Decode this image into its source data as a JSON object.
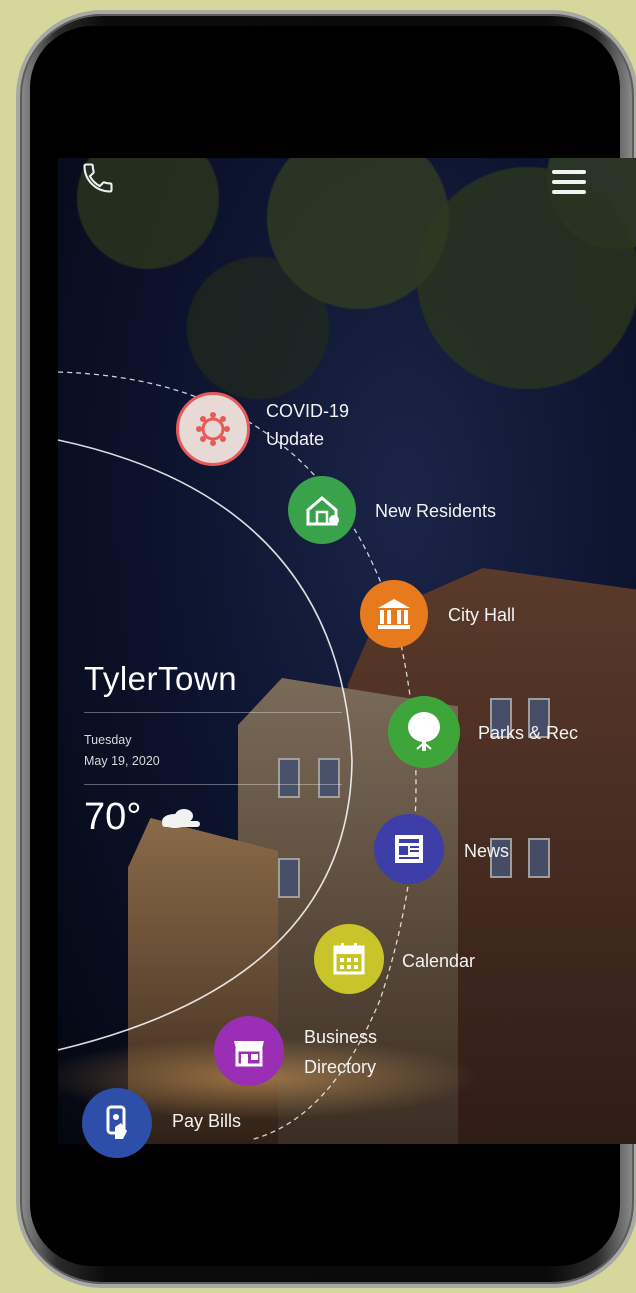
{
  "app": {
    "town_name": "TylerTown",
    "day": "Tuesday",
    "date": "May 19, 2020",
    "temperature": "70°",
    "weather_icon": "partly-cloudy-icon"
  },
  "header": {
    "phone_icon": "phone-icon",
    "menu_icon": "hamburger-menu-icon"
  },
  "menu": {
    "covid": {
      "line1": "COVID-19",
      "line2": "Update",
      "color": "#e65a5a"
    },
    "new_residents": {
      "label": "New Residents",
      "color": "#3aa24a"
    },
    "city_hall": {
      "label": "City Hall",
      "color": "#e87a1e"
    },
    "parks": {
      "label": "Parks & Rec",
      "color": "#3ea53a"
    },
    "news": {
      "label": "News",
      "color": "#3d3ea8"
    },
    "calendar": {
      "label": "Calendar",
      "color": "#c9c42a"
    },
    "business": {
      "line1": "Business",
      "line2": "Directory",
      "color": "#9a2fb5"
    },
    "pay_bills": {
      "label": "Pay Bills",
      "color": "#2d4ea9"
    }
  },
  "colors": {
    "background": "#d6d89b",
    "screen_night": "#0d1430"
  }
}
